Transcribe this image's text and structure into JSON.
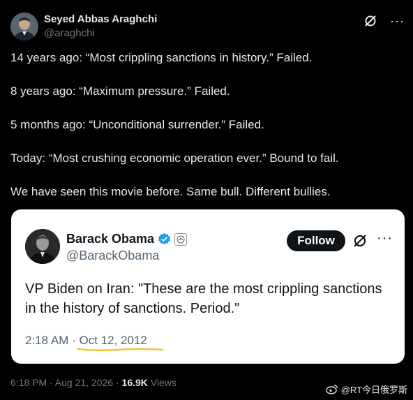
{
  "tweet": {
    "author_name": "Seyed Abbas Araghchi",
    "author_handle": "@araghchi",
    "lines": [
      "14 years ago: “Most crippling sanctions in history.” Failed.",
      "8 years ago: “Maximum pressure.” Failed.",
      "5 months ago: “Unconditional surrender.” Failed.",
      "Today: “Most crushing economic operation ever.” Bound to fail.",
      "We have seen this movie before. Same bull. Different bullies."
    ],
    "footer_time": "6:18 PM · Aug 21, 2026 · ",
    "footer_views_count": "16.9K",
    "footer_views_label": " Views"
  },
  "quoted": {
    "author_name": "Barack Obama",
    "author_handle": "@BarackObama",
    "follow_label": "Follow",
    "text": "VP Biden on Iran: \"These are the most crippling sanctions in the history of sanctions. Period.\"",
    "time": "2:18 AM · ",
    "date": "Oct 12, 2012"
  },
  "watermark": {
    "text": "@RT今日俄罗斯"
  },
  "colors": {
    "background": "#000000",
    "text_primary": "#e7e9ea",
    "text_secondary": "#71767b",
    "verified_blue": "#1d9bf0",
    "highlight": "#f4c43a"
  },
  "icons": {
    "grok": "grok-icon",
    "more": "more-dots-icon",
    "verified": "verified-badge-icon",
    "government": "government-seal-icon",
    "weibo": "weibo-logo-icon"
  }
}
